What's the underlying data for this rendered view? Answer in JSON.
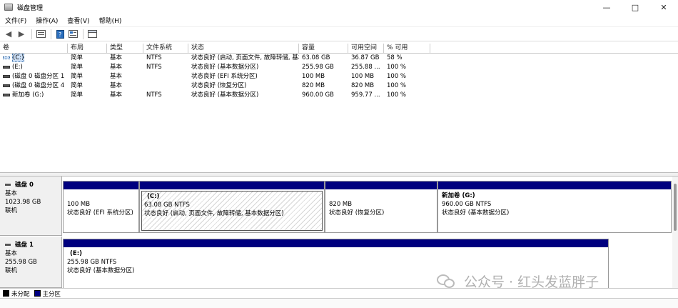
{
  "window": {
    "title": "磁盘管理"
  },
  "menu": [
    "文件(F)",
    "操作(A)",
    "查看(V)",
    "帮助(H)"
  ],
  "table": {
    "columns": [
      "卷",
      "布局",
      "类型",
      "文件系统",
      "状态",
      "容量",
      "可用空间",
      "% 可用"
    ],
    "rows": [
      [
        "(C:)",
        "简单",
        "基本",
        "NTFS",
        "状态良好 (启动, 页面文件, 故障转储, 基本数据分区)",
        "63.08 GB",
        "36.87 GB",
        "58 %"
      ],
      [
        "(E:)",
        "简单",
        "基本",
        "NTFS",
        "状态良好 (基本数据分区)",
        "255.98 GB",
        "255.88 ...",
        "100 %"
      ],
      [
        "(磁盘 0 磁盘分区 1)",
        "简单",
        "基本",
        "",
        "状态良好 (EFI 系统分区)",
        "100 MB",
        "100 MB",
        "100 %"
      ],
      [
        "(磁盘 0 磁盘分区 4)",
        "简单",
        "基本",
        "",
        "状态良好 (恢复分区)",
        "820 MB",
        "820 MB",
        "100 %"
      ],
      [
        "新加卷 (G:)",
        "简单",
        "基本",
        "NTFS",
        "状态良好 (基本数据分区)",
        "960.00 GB",
        "959.77 ...",
        "100 %"
      ]
    ]
  },
  "disks": [
    {
      "name": "磁盘 0",
      "type": "基本",
      "size": "1023.98 GB",
      "status": "联机",
      "partitions": [
        {
          "name": "",
          "size": "100 MB",
          "status": "状态良好 (EFI 系统分区)"
        },
        {
          "name": "(C:)",
          "size": "63.08 GB NTFS",
          "status": "状态良好 (启动, 页面文件, 故障转储, 基本数据分区)"
        },
        {
          "name": "",
          "size": "820 MB",
          "status": "状态良好 (恢复分区)"
        },
        {
          "name": "新加卷  (G:)",
          "size": "960.00 GB NTFS",
          "status": "状态良好 (基本数据分区)"
        }
      ]
    },
    {
      "name": "磁盘 1",
      "type": "基本",
      "size": "255.98 GB",
      "status": "联机",
      "partitions": [
        {
          "name": "(E:)",
          "size": "255.98 GB NTFS",
          "status": "状态良好 (基本数据分区)"
        }
      ]
    }
  ],
  "legend": [
    {
      "label": "未分配",
      "color": "#000000"
    },
    {
      "label": "主分区",
      "color": "#00007f"
    }
  ],
  "watermark": "公众号 · 红头发蓝胖子"
}
